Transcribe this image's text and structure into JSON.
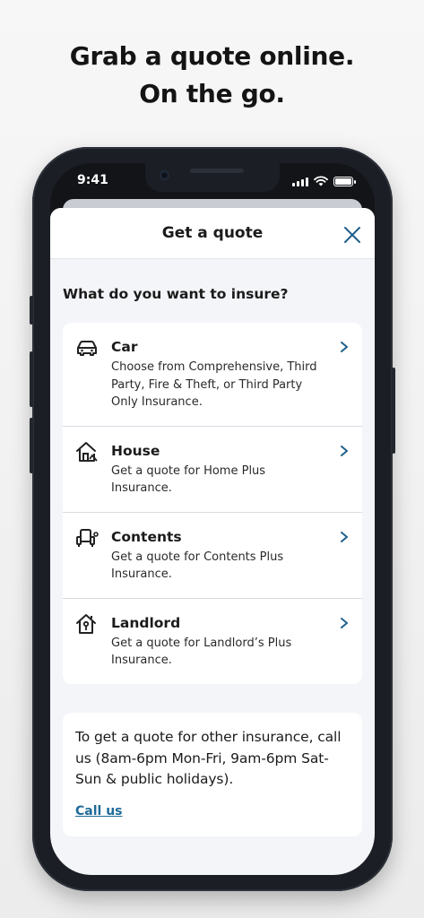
{
  "hero": {
    "line1": "Grab a quote online.",
    "line2": "On the go."
  },
  "status_bar": {
    "time": "9:41"
  },
  "sheet": {
    "title": "Get a quote",
    "question": "What do you want to insure?"
  },
  "options": [
    {
      "title": "Car",
      "description": "Choose from Comprehensive, Third Party, Fire & Theft, or Third Party Only Insurance.",
      "icon": "car-icon"
    },
    {
      "title": "House",
      "description": "Get a quote for Home Plus Insurance.",
      "icon": "house-icon"
    },
    {
      "title": "Contents",
      "description": "Get a quote for Contents Plus Insurance.",
      "icon": "armchair-icon"
    },
    {
      "title": "Landlord",
      "description": "Get a quote for Landlord’s Plus Insurance.",
      "icon": "house-key-icon"
    }
  ],
  "info": {
    "text": "To get a quote for other insurance, call us (8am-6pm Mon-Fri, 9am-6pm Sat-Sun & public holidays).",
    "link_label": "Call us"
  },
  "colors": {
    "accent": "#1e6a99",
    "text": "#1b1b1b",
    "sheet_bg": "#f4f5f9"
  }
}
